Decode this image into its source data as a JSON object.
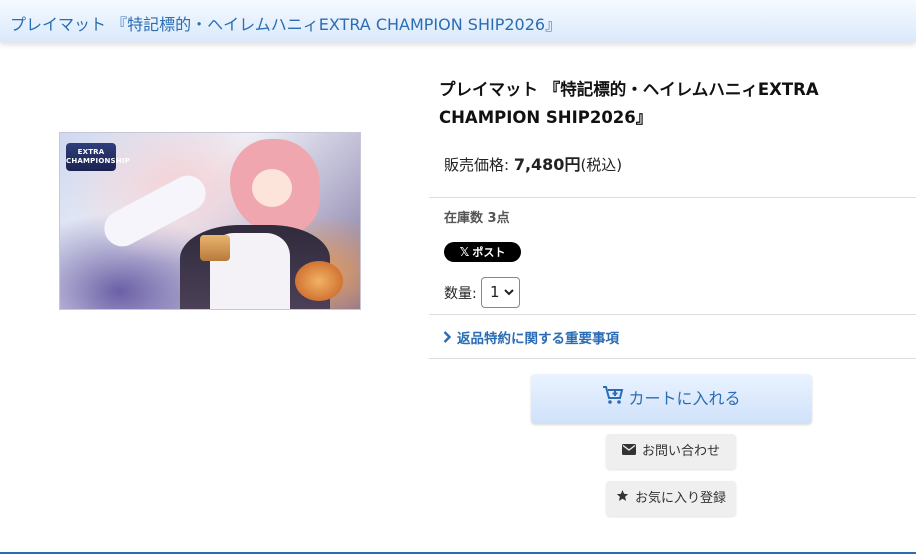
{
  "header": {
    "title": "プレイマット 『特記標的・ヘイレムハニィEXTRA CHAMPION SHIP2026』"
  },
  "product": {
    "image_logo_text": "EXTRA CHAMPIONSHIP",
    "title": "プレイマット 『特記標的・ヘイレムハニィEXTRA CHAMPION SHIP2026』",
    "price_label": "販売価格: ",
    "price_value": "7,480円",
    "price_tax": "(税込)",
    "stock": "在庫数 3点",
    "post_button": "ポスト",
    "quantity_label": "数量:",
    "quantity_value": "1",
    "returns_link": "返品特約に関する重要事項"
  },
  "actions": {
    "cart": "カートに入れる",
    "inquiry": "お問い合わせ",
    "favorite": "お気に入り登録"
  },
  "colors": {
    "accent": "#2a6db4",
    "header_bg": "#d9e9fb"
  }
}
